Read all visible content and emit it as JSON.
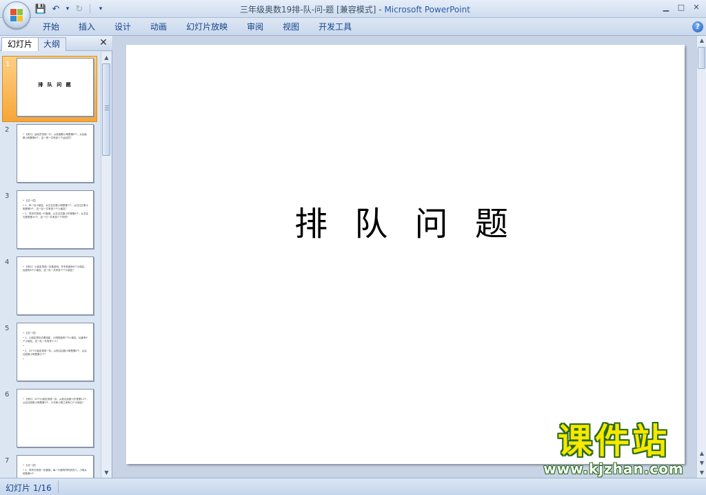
{
  "window": {
    "title": "三年级奥数19排-队-问-题 [兼容模式]",
    "title_separator": " - ",
    "app_name": "Microsoft PowerPoint",
    "controls": {
      "minimize": "▁",
      "maximize": "□",
      "close": "✕"
    }
  },
  "quick_access": {
    "save_icon": "💾",
    "undo_icon": "↶",
    "undo_dropdown": "▾",
    "redo_icon": "↻",
    "customize": "▾"
  },
  "ribbon": {
    "tabs": [
      "开始",
      "插入",
      "设计",
      "动画",
      "幻灯片放映",
      "审阅",
      "视图",
      "开发工具"
    ],
    "help": "?"
  },
  "left_panel": {
    "tabs": [
      "幻灯片",
      "大纲"
    ],
    "close": "✕",
    "slides": [
      {
        "num": "1",
        "title": "排 队 问 题",
        "lines": []
      },
      {
        "num": "2",
        "title": "",
        "lines": [
          "• 【例1】 运动员排成一行，从前面数小明是第6个，从后面数小明是第8个，这一排一共有多少个运动员？"
        ]
      },
      {
        "num": "3",
        "title": "",
        "lines": [
          "• 【试一试】",
          "• 1、有一队小朋友，从左往右数小明是第7个，从右往左数小明是第9个，这一队一共有多少个小朋友？",
          "• 2、同学们排成一行做操，从左往右数小华是第8个，从右往左数是第10个，这一行一共有多少个同学？"
        ]
      },
      {
        "num": "4",
        "title": "",
        "lines": [
          "• 【例2】 小朋友排成一队做游戏，冬冬前面有6个小朋友，后面有8个小朋友，这一队一共有多少个小朋友？"
        ]
      },
      {
        "num": "5",
        "title": "",
        "lines": [
          "• 【试一试】",
          "• 1、小朋友排队去看电影，小明前面有7个小朋友，后面有9个小朋友，这一队一共有多少人？",
          "•",
          "• 2、20个小朋友排成一队，从前往后数小明是第8个，从后往前数小明是第几个？",
          "•"
        ]
      },
      {
        "num": "6",
        "title": "",
        "lines": [
          "• 【例3】 20个小朋友排成一队，从前往后数小东是第12个，从后往前数小明是第5个，小东和小明之间有几个小朋友？"
        ]
      },
      {
        "num": "7",
        "title": "",
        "lines": [
          "• 【试一试】",
          "• 1、同学们排成一队做操，每一行都有同样多的人，小明从前数第4个"
        ]
      }
    ]
  },
  "slide": {
    "title": "排 队 问 题"
  },
  "status": {
    "slide_indicator": "幻灯片 1/16"
  },
  "watermark": {
    "brand": "课件站",
    "url": "www.kjzhan.com"
  }
}
